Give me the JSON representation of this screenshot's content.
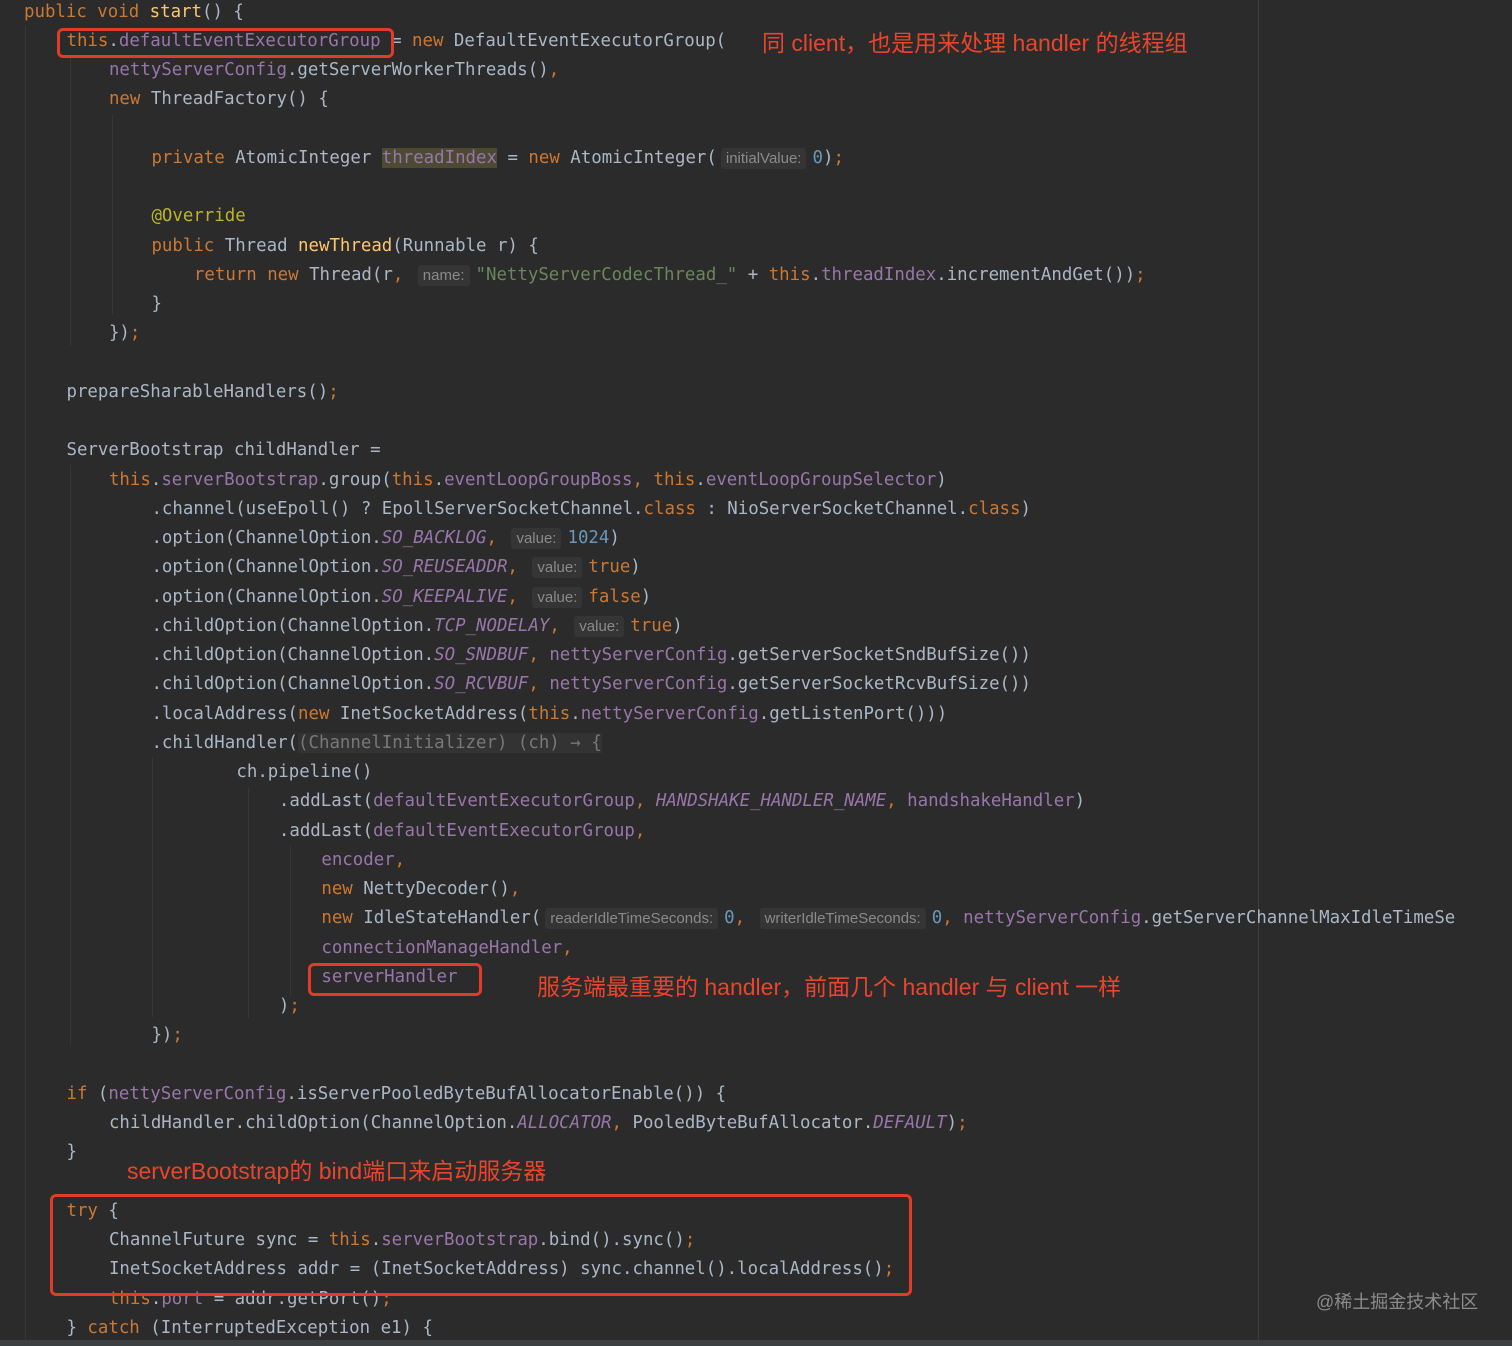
{
  "editor": {
    "lines": [
      {
        "indent": 0,
        "tokens": [
          [
            "public void ",
            "k"
          ],
          [
            "start",
            "m"
          ],
          [
            "() {",
            "p"
          ]
        ]
      },
      {
        "indent": 4,
        "tokens": [
          [
            "this",
            "k"
          ],
          [
            ".",
            "p"
          ],
          [
            "defaultEventExecutorGroup",
            "f"
          ],
          [
            " = ",
            "p"
          ],
          [
            "new ",
            "k"
          ],
          [
            "DefaultEventExecutorGroup(",
            "p"
          ]
        ]
      },
      {
        "indent": 8,
        "tokens": [
          [
            "nettyServerConfig",
            "f"
          ],
          [
            ".getServerWorkerThreads()",
            "p"
          ],
          [
            ",",
            "k"
          ]
        ]
      },
      {
        "indent": 8,
        "tokens": [
          [
            "new ",
            "k"
          ],
          [
            "ThreadFactory() {",
            "p"
          ]
        ]
      },
      {
        "indent": 0,
        "tokens": []
      },
      {
        "indent": 12,
        "tokens": [
          [
            "private ",
            "k"
          ],
          [
            "AtomicInteger ",
            "p"
          ],
          [
            "threadIndex",
            "fh"
          ],
          [
            " = ",
            "p"
          ],
          [
            "new ",
            "k"
          ],
          [
            "AtomicInteger(",
            "p"
          ],
          [
            "initialValue:",
            "h"
          ],
          [
            "0",
            "n"
          ],
          [
            ")",
            "p"
          ],
          [
            ";",
            "k"
          ]
        ]
      },
      {
        "indent": 0,
        "tokens": []
      },
      {
        "indent": 12,
        "tokens": [
          [
            "@Override",
            "a"
          ]
        ]
      },
      {
        "indent": 12,
        "tokens": [
          [
            "public ",
            "k"
          ],
          [
            "Thread ",
            "p"
          ],
          [
            "newThread",
            "m"
          ],
          [
            "(Runnable r) {",
            "p"
          ]
        ]
      },
      {
        "indent": 16,
        "tokens": [
          [
            "return new ",
            "k"
          ],
          [
            "Thread(r",
            "p"
          ],
          [
            ", ",
            "k"
          ],
          [
            "name:",
            "h"
          ],
          [
            "\"NettyServerCodecThread_\"",
            "s"
          ],
          [
            " + ",
            "p"
          ],
          [
            "this",
            "k"
          ],
          [
            ".",
            "p"
          ],
          [
            "threadIndex",
            "f"
          ],
          [
            ".incrementAndGet())",
            "p"
          ],
          [
            ";",
            "k"
          ]
        ]
      },
      {
        "indent": 12,
        "tokens": [
          [
            "}",
            "p"
          ]
        ]
      },
      {
        "indent": 8,
        "tokens": [
          [
            "})",
            "p"
          ],
          [
            ";",
            "k"
          ]
        ]
      },
      {
        "indent": 0,
        "tokens": []
      },
      {
        "indent": 4,
        "tokens": [
          [
            "prepareSharableHandlers()",
            "p"
          ],
          [
            ";",
            "k"
          ]
        ]
      },
      {
        "indent": 0,
        "tokens": []
      },
      {
        "indent": 4,
        "tokens": [
          [
            "ServerBootstrap childHandler =",
            "p"
          ]
        ]
      },
      {
        "indent": 8,
        "tokens": [
          [
            "this",
            "k"
          ],
          [
            ".",
            "p"
          ],
          [
            "serverBootstrap",
            "f"
          ],
          [
            ".group(",
            "p"
          ],
          [
            "this",
            "k"
          ],
          [
            ".",
            "p"
          ],
          [
            "eventLoopGroupBoss",
            "f"
          ],
          [
            ", ",
            "k"
          ],
          [
            "this",
            "k"
          ],
          [
            ".",
            "p"
          ],
          [
            "eventLoopGroupSelector",
            "f"
          ],
          [
            ")",
            "p"
          ]
        ]
      },
      {
        "indent": 12,
        "tokens": [
          [
            ".channel(useEpoll() ? EpollServerSocketChannel.",
            "p"
          ],
          [
            "class",
            "k"
          ],
          [
            " : NioServerSocketChannel.",
            "p"
          ],
          [
            "class",
            "k"
          ],
          [
            ")",
            "p"
          ]
        ]
      },
      {
        "indent": 12,
        "tokens": [
          [
            ".option(ChannelOption.",
            "p"
          ],
          [
            "SO_BACKLOG",
            "i"
          ],
          [
            ", ",
            "k"
          ],
          [
            "value:",
            "h"
          ],
          [
            "1024",
            "n"
          ],
          [
            ")",
            "p"
          ]
        ]
      },
      {
        "indent": 12,
        "tokens": [
          [
            ".option(ChannelOption.",
            "p"
          ],
          [
            "SO_REUSEADDR",
            "i"
          ],
          [
            ", ",
            "k"
          ],
          [
            "value:",
            "h"
          ],
          [
            "true",
            "k"
          ],
          [
            ")",
            "p"
          ]
        ]
      },
      {
        "indent": 12,
        "tokens": [
          [
            ".option(ChannelOption.",
            "p"
          ],
          [
            "SO_KEEPALIVE",
            "i"
          ],
          [
            ", ",
            "k"
          ],
          [
            "value:",
            "h"
          ],
          [
            "false",
            "k"
          ],
          [
            ")",
            "p"
          ]
        ]
      },
      {
        "indent": 12,
        "tokens": [
          [
            ".childOption(ChannelOption.",
            "p"
          ],
          [
            "TCP_NODELAY",
            "i"
          ],
          [
            ", ",
            "k"
          ],
          [
            "value:",
            "h"
          ],
          [
            "true",
            "k"
          ],
          [
            ")",
            "p"
          ]
        ]
      },
      {
        "indent": 12,
        "tokens": [
          [
            ".childOption(ChannelOption.",
            "p"
          ],
          [
            "SO_SNDBUF",
            "i"
          ],
          [
            ", ",
            "k"
          ],
          [
            "nettyServerConfig",
            "f"
          ],
          [
            ".getServerSocketSndBufSize())",
            "p"
          ]
        ]
      },
      {
        "indent": 12,
        "tokens": [
          [
            ".childOption(ChannelOption.",
            "p"
          ],
          [
            "SO_RCVBUF",
            "i"
          ],
          [
            ", ",
            "k"
          ],
          [
            "nettyServerConfig",
            "f"
          ],
          [
            ".getServerSocketRcvBufSize())",
            "p"
          ]
        ]
      },
      {
        "indent": 12,
        "tokens": [
          [
            ".localAddress(",
            "p"
          ],
          [
            "new ",
            "k"
          ],
          [
            "InetSocketAddress(",
            "p"
          ],
          [
            "this",
            "k"
          ],
          [
            ".",
            "p"
          ],
          [
            "nettyServerConfig",
            "f"
          ],
          [
            ".getListenPort()))",
            "p"
          ]
        ]
      },
      {
        "indent": 12,
        "tokens": [
          [
            ".childHandler(",
            "p"
          ],
          [
            "(ChannelInitializer) (ch) → {",
            "g"
          ]
        ]
      },
      {
        "indent": 20,
        "tokens": [
          [
            "ch.pipeline()",
            "p"
          ]
        ]
      },
      {
        "indent": 24,
        "tokens": [
          [
            ".addLast(",
            "p"
          ],
          [
            "defaultEventExecutorGroup",
            "f"
          ],
          [
            ", ",
            "k"
          ],
          [
            "HANDSHAKE_HANDLER_NAME",
            "i"
          ],
          [
            ", ",
            "k"
          ],
          [
            "handshakeHandler",
            "f"
          ],
          [
            ")",
            "p"
          ]
        ]
      },
      {
        "indent": 24,
        "tokens": [
          [
            ".addLast(",
            "p"
          ],
          [
            "defaultEventExecutorGroup",
            "f"
          ],
          [
            ",",
            "k"
          ]
        ]
      },
      {
        "indent": 28,
        "tokens": [
          [
            "encoder",
            "f"
          ],
          [
            ",",
            "k"
          ]
        ]
      },
      {
        "indent": 28,
        "tokens": [
          [
            "new ",
            "k"
          ],
          [
            "NettyDecoder()",
            "p"
          ],
          [
            ",",
            "k"
          ]
        ]
      },
      {
        "indent": 28,
        "tokens": [
          [
            "new ",
            "k"
          ],
          [
            "IdleStateHandler(",
            "p"
          ],
          [
            "readerIdleTimeSeconds:",
            "h"
          ],
          [
            "0",
            "n"
          ],
          [
            ", ",
            "k"
          ],
          [
            "writerIdleTimeSeconds:",
            "h"
          ],
          [
            "0",
            "n"
          ],
          [
            ", ",
            "k"
          ],
          [
            "nettyServerConfig",
            "f"
          ],
          [
            ".getServerChannelMaxIdleTimeSe",
            "p"
          ]
        ]
      },
      {
        "indent": 28,
        "tokens": [
          [
            "connectionManageHandler",
            "f"
          ],
          [
            ",",
            "k"
          ]
        ]
      },
      {
        "indent": 28,
        "tokens": [
          [
            "serverHandler",
            "f"
          ]
        ]
      },
      {
        "indent": 24,
        "tokens": [
          [
            ")",
            "p"
          ],
          [
            ";",
            "k"
          ]
        ]
      },
      {
        "indent": 12,
        "tokens": [
          [
            "})",
            "p"
          ],
          [
            ";",
            "k"
          ]
        ]
      },
      {
        "indent": 0,
        "tokens": []
      },
      {
        "indent": 4,
        "tokens": [
          [
            "if ",
            "k"
          ],
          [
            "(",
            "p"
          ],
          [
            "nettyServerConfig",
            "f"
          ],
          [
            ".isServerPooledByteBufAllocatorEnable()) {",
            "p"
          ]
        ]
      },
      {
        "indent": 8,
        "tokens": [
          [
            "childHandler.childOption(ChannelOption.",
            "p"
          ],
          [
            "ALLOCATOR",
            "i"
          ],
          [
            ", ",
            "k"
          ],
          [
            "PooledByteBufAllocator.",
            "p"
          ],
          [
            "DEFAULT",
            "i"
          ],
          [
            ")",
            "p"
          ],
          [
            ";",
            "k"
          ]
        ]
      },
      {
        "indent": 4,
        "tokens": [
          [
            "}",
            "p"
          ]
        ]
      },
      {
        "indent": 0,
        "tokens": []
      },
      {
        "indent": 4,
        "tokens": [
          [
            "try ",
            "k"
          ],
          [
            "{",
            "p"
          ]
        ]
      },
      {
        "indent": 8,
        "tokens": [
          [
            "ChannelFuture sync = ",
            "p"
          ],
          [
            "this",
            "k"
          ],
          [
            ".",
            "p"
          ],
          [
            "serverBootstrap",
            "f"
          ],
          [
            ".bind().sync()",
            "p"
          ],
          [
            ";",
            "k"
          ]
        ]
      },
      {
        "indent": 8,
        "tokens": [
          [
            "InetSocketAddress addr = (InetSocketAddress) sync.channel().localAddress()",
            "p"
          ],
          [
            ";",
            "k"
          ]
        ]
      },
      {
        "indent": 8,
        "tokens": [
          [
            "this",
            "k"
          ],
          [
            ".",
            "p"
          ],
          [
            "port",
            "f"
          ],
          [
            " = addr.getPort()",
            "p"
          ],
          [
            ";",
            "k"
          ]
        ]
      },
      {
        "indent": 4,
        "tokens": [
          [
            "} ",
            "p"
          ],
          [
            "catch ",
            "k"
          ],
          [
            "(InterruptedException e1) {",
            "p"
          ]
        ]
      }
    ]
  },
  "annotations": {
    "executor_group_note": "同 client，也是用来处理 handler 的线程组",
    "server_handler_note": "服务端最重要的 handler，前面几个 handler 与 client 一样",
    "bind_note": "serverBootstrap的 bind端口来启动服务器"
  },
  "watermark": "@稀土掘金技术社区",
  "colors": {
    "background": "#2b2b2b",
    "keyword": "#cc7832",
    "field": "#9876aa",
    "string": "#6a8759",
    "annotation_red": "#e8452c"
  }
}
